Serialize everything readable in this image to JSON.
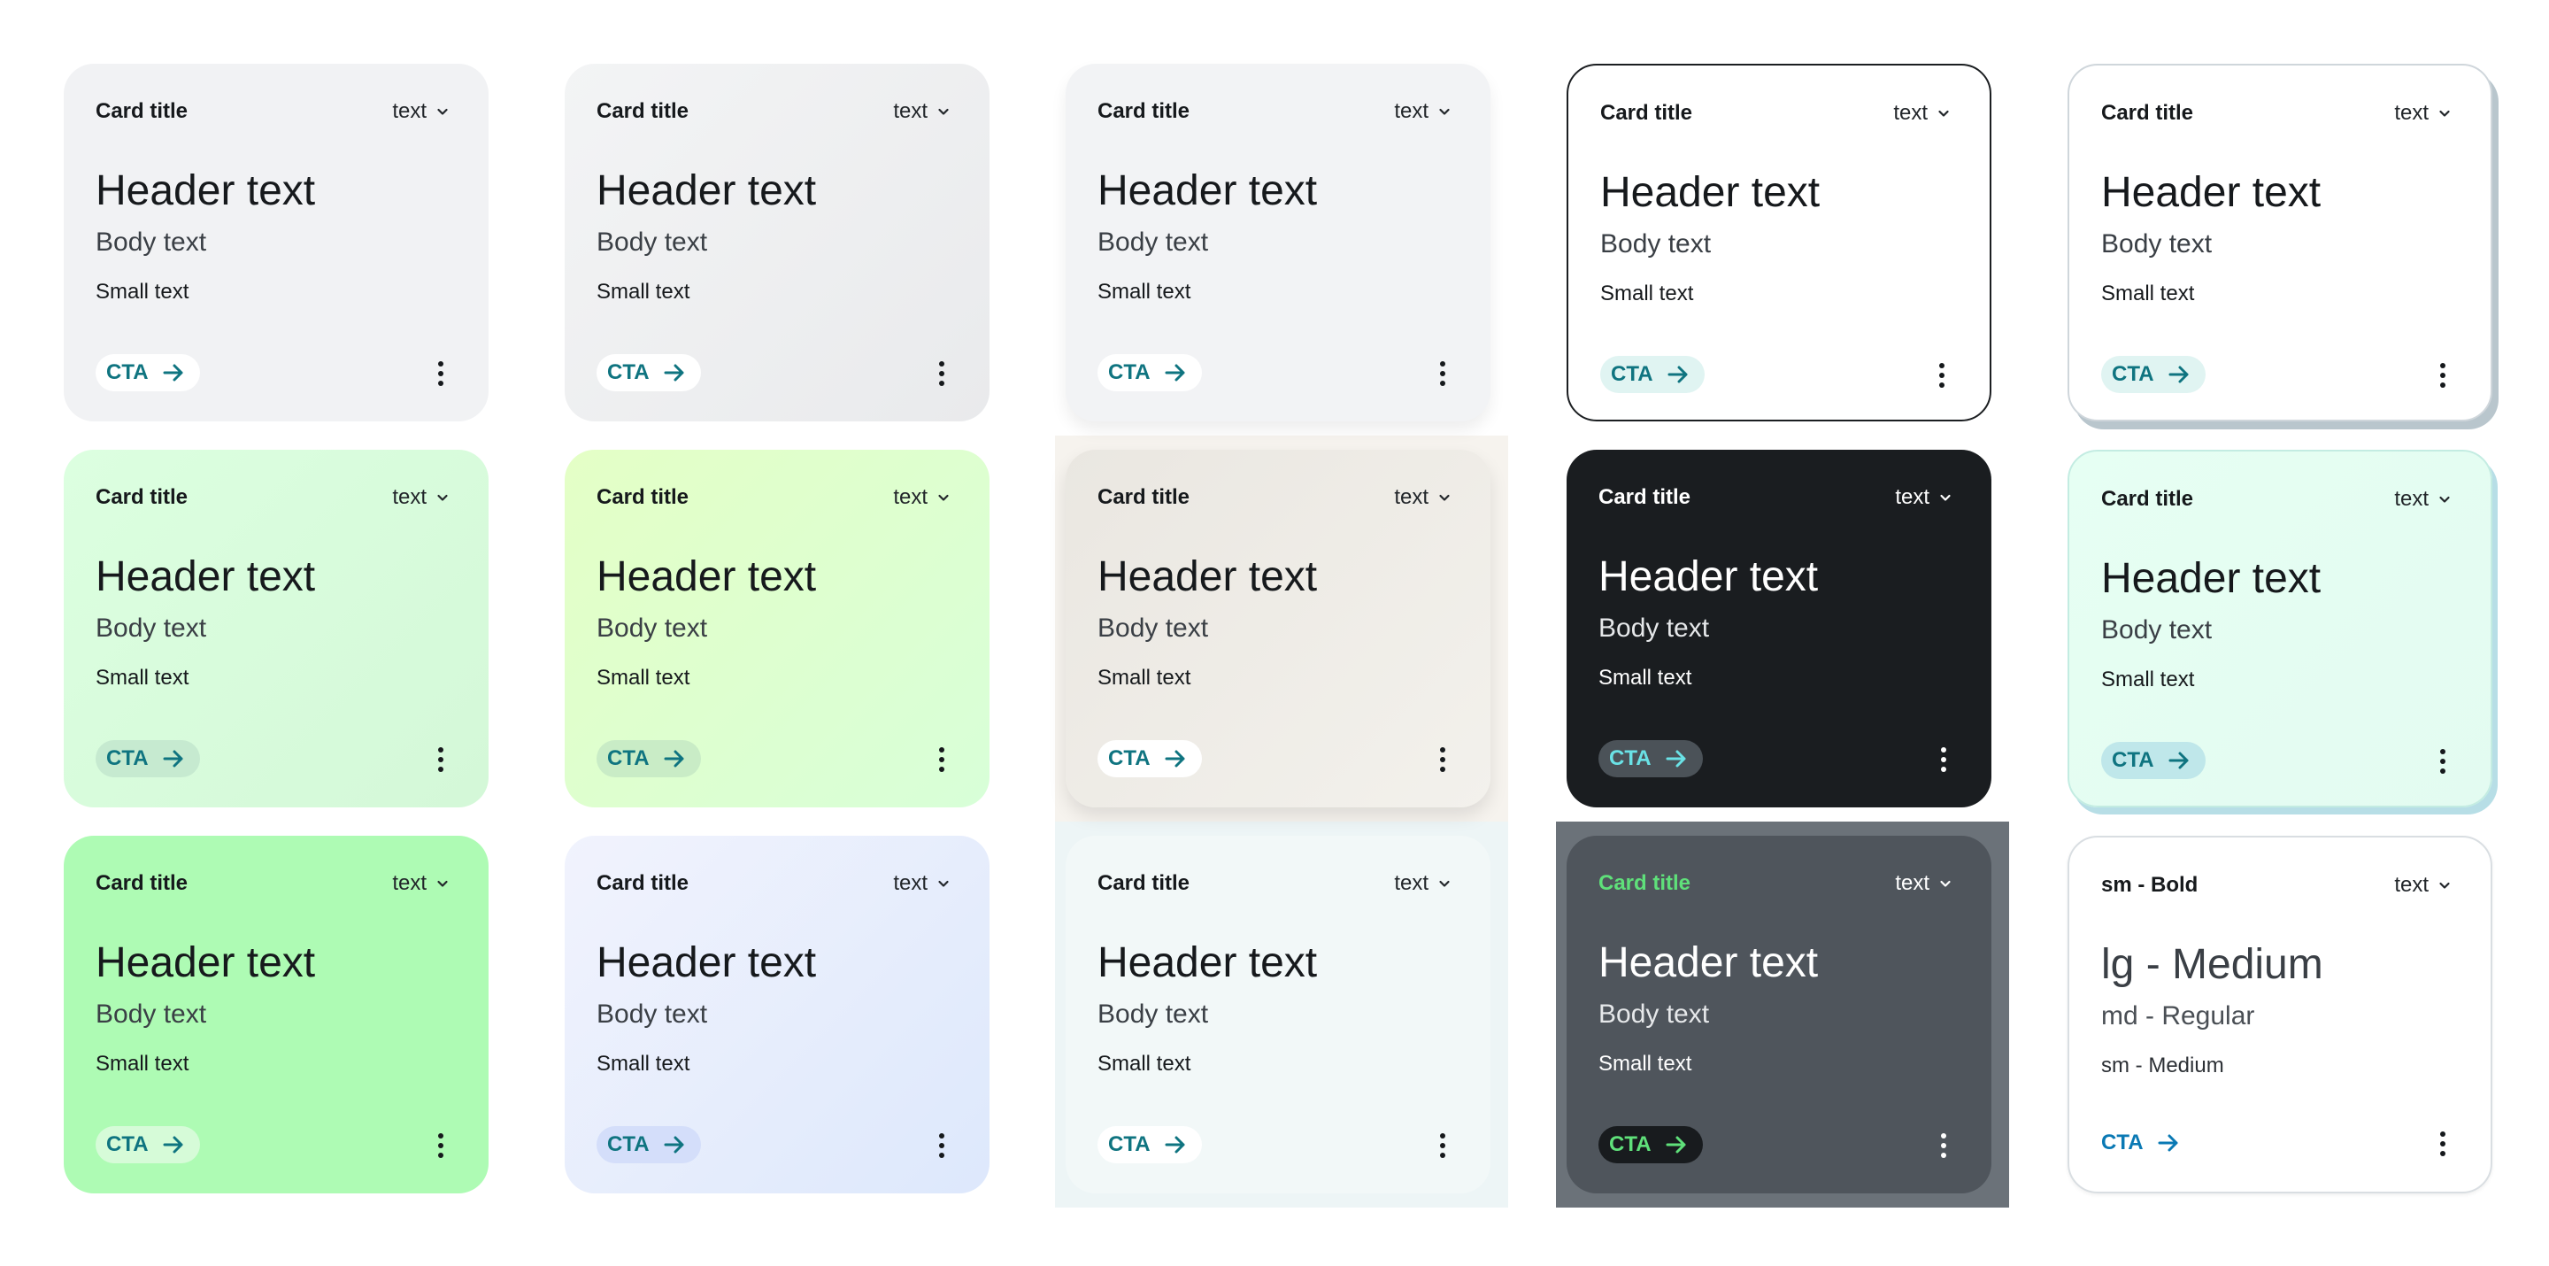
{
  "cards": [
    {
      "title": "Card title",
      "dropdown": "text",
      "header": "Header text",
      "body": "Body text",
      "small": "Small text",
      "cta": "CTA"
    },
    {
      "title": "Card title",
      "dropdown": "text",
      "header": "Header text",
      "body": "Body text",
      "small": "Small text",
      "cta": "CTA"
    },
    {
      "title": "Card title",
      "dropdown": "text",
      "header": "Header text",
      "body": "Body text",
      "small": "Small text",
      "cta": "CTA"
    },
    {
      "title": "Card title",
      "dropdown": "text",
      "header": "Header text",
      "body": "Body text",
      "small": "Small text",
      "cta": "CTA"
    },
    {
      "title": "Card title",
      "dropdown": "text",
      "header": "Header text",
      "body": "Body text",
      "small": "Small text",
      "cta": "CTA"
    },
    {
      "title": "Card title",
      "dropdown": "text",
      "header": "Header text",
      "body": "Body text",
      "small": "Small text",
      "cta": "CTA"
    },
    {
      "title": "Card title",
      "dropdown": "text",
      "header": "Header text",
      "body": "Body text",
      "small": "Small text",
      "cta": "CTA"
    },
    {
      "title": "Card title",
      "dropdown": "text",
      "header": "Header text",
      "body": "Body text",
      "small": "Small text",
      "cta": "CTA"
    },
    {
      "title": "Card title",
      "dropdown": "text",
      "header": "Header text",
      "body": "Body text",
      "small": "Small text",
      "cta": "CTA"
    },
    {
      "title": "Card title",
      "dropdown": "text",
      "header": "Header text",
      "body": "Body text",
      "small": "Small text",
      "cta": "CTA"
    },
    {
      "title": "Card title",
      "dropdown": "text",
      "header": "Header text",
      "body": "Body text",
      "small": "Small text",
      "cta": "CTA"
    },
    {
      "title": "Card title",
      "dropdown": "text",
      "header": "Header text",
      "body": "Body text",
      "small": "Small text",
      "cta": "CTA"
    },
    {
      "title": "Card title",
      "dropdown": "text",
      "header": "Header text",
      "body": "Body text",
      "small": "Small text",
      "cta": "CTA"
    },
    {
      "title": "Card title",
      "dropdown": "text",
      "header": "Header text",
      "body": "Body text",
      "small": "Small text",
      "cta": "CTA"
    },
    {
      "title": "sm - Bold",
      "dropdown": "text",
      "header": "lg - Medium",
      "body": "md - Regular",
      "small": "sm - Medium",
      "cta": "CTA"
    }
  ],
  "icons": {
    "dropdown": "chevron-down-icon",
    "cta": "arrow-right-icon",
    "menu": "more-vertical-icon"
  },
  "colors": {
    "accent_teal": "#0f7480",
    "dark_card": "#1a1d20",
    "slate_card": "#4f555c",
    "green_title": "#5fe07a"
  }
}
